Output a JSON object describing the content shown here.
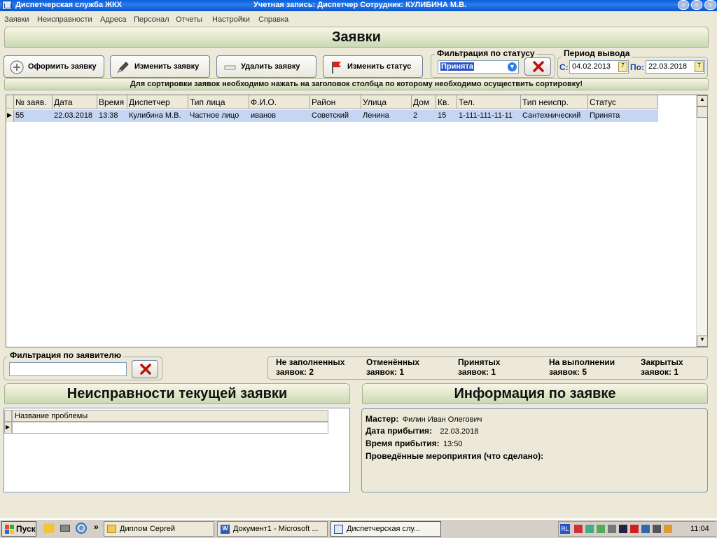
{
  "window": {
    "title": "Диспетчерская служба ЖКХ",
    "account": "Учетная запись:  Диспетчер   Сотрудник: КУЛИБИНА М.В."
  },
  "menu": [
    "Заявки",
    "Неисправности",
    "Адреса",
    "Персонал",
    "Отчеты",
    "Настройки",
    "Справка"
  ],
  "header": {
    "title": "Заявки"
  },
  "toolbar": {
    "create": "Оформить заявку",
    "edit": "Изменить заявку",
    "delete": "Удалить заявку",
    "status": "Изменить статус"
  },
  "status_filter": {
    "label": "Фильтрация по статусу",
    "value": "Принята"
  },
  "period": {
    "label": "Период вывода",
    "from_label": "С:",
    "from": "04.02.2013",
    "to_label": "По:",
    "to": "22.03.2018"
  },
  "sort_hint": "Для сортировки заявок необходимо нажать на заголовок столбца по которому необходимо осуществить сортировку!",
  "table": {
    "columns": [
      "№ заяв.",
      "Дата",
      "Время",
      "Диспетчер",
      "Тип лица",
      "Ф.И.О.",
      "Район",
      "Улица",
      "Дом",
      "Кв.",
      "Тел.",
      "Тип неиспр.",
      "Статус"
    ],
    "rows": [
      [
        "55",
        "22.03.2018",
        "13:38",
        "Кулибина М.В.",
        "Частное лицо",
        "иванов",
        "Советский",
        "Ленина",
        "2",
        "15",
        "1-111-111-11-11",
        "Сантехнический",
        "Принята"
      ]
    ]
  },
  "applicant_filter": {
    "label": "Фильтрация по заявителю",
    "value": ""
  },
  "stats": [
    {
      "line1": "Не заполненных",
      "line2": "заявок: 2"
    },
    {
      "line1": "Отменённых",
      "line2": "заявок: 1"
    },
    {
      "line1": "Принятых",
      "line2": "заявок: 1"
    },
    {
      "line1": "На выполнении",
      "line2": "заявок: 5"
    },
    {
      "line1": "Закрытых",
      "line2": "заявок: 1"
    }
  ],
  "faults": {
    "title": "Неисправности текущей заявки",
    "column": "Название проблемы"
  },
  "info": {
    "title": "Информация по заявке",
    "master_label": "Мастер:",
    "master": "Филин Иван Олегович",
    "date_label": "Дата прибытия:",
    "date": "22.03.2018",
    "time_label": "Время прибытия:",
    "time": "13:50",
    "done_label": "Проведённые мероприятия (что сделано):"
  },
  "taskbar": {
    "start": "Пуск",
    "tasks": [
      "Диплом Сергей",
      "Документ1 - Microsoft ...",
      "Диспетчерская слу..."
    ],
    "lang": "RL",
    "clock": "11:04"
  }
}
